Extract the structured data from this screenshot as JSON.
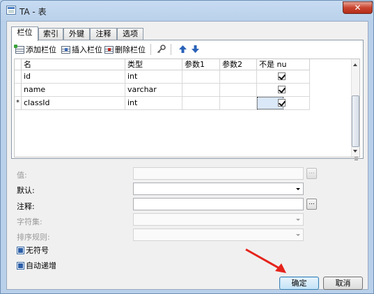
{
  "window": {
    "title": "TA - 表",
    "close_symbol": "✕"
  },
  "tabs": [
    {
      "label": "栏位",
      "active": true
    },
    {
      "label": "索引",
      "active": false
    },
    {
      "label": "外键",
      "active": false
    },
    {
      "label": "注释",
      "active": false
    },
    {
      "label": "选项",
      "active": false
    }
  ],
  "toolbar": {
    "add_field": "添加栏位",
    "insert_field": "插入栏位",
    "delete_field": "删除栏位",
    "primary_key_icon": "key-icon",
    "move_up_icon": "arrow-up-icon",
    "move_down_icon": "arrow-down-icon"
  },
  "grid": {
    "columns": [
      "名",
      "类型",
      "参数1",
      "参数2",
      "不是 nu"
    ],
    "rows": [
      {
        "marker": "",
        "name": "id",
        "type": "int",
        "param1": "",
        "param2": "",
        "not_null": true
      },
      {
        "marker": "",
        "name": "name",
        "type": "varchar",
        "param1": "",
        "param2": "",
        "not_null": true
      },
      {
        "marker": "*",
        "name": "classId",
        "type": "int",
        "param1": "",
        "param2": "",
        "not_null": true
      }
    ]
  },
  "properties": {
    "value_label": "值:",
    "default_label": "默认:",
    "comment_label": "注释:",
    "charset_label": "字符集:",
    "collation_label": "排序规则:",
    "unsigned_label": "无符号",
    "auto_increment_label": "自动递增",
    "ellipsis": "..."
  },
  "buttons": {
    "ok": "确定",
    "cancel": "取消"
  },
  "colors": {
    "accent": "#2c5fa8",
    "annotation_arrow": "#e5231b",
    "close": "#c9442f"
  }
}
